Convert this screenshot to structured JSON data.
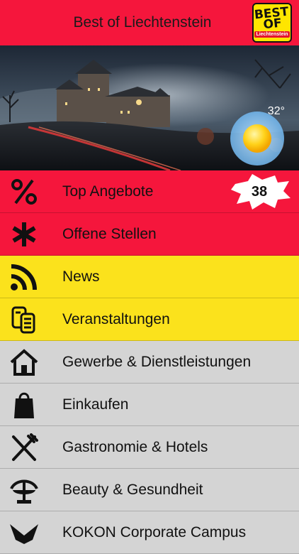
{
  "header": {
    "title": "Best of Liechtenstein",
    "logo_big": "BEST OF",
    "logo_small": "Liechtenstein"
  },
  "weather": {
    "temperature": "32°",
    "icon": "sun-icon"
  },
  "menu": [
    {
      "label": "Top Angebote",
      "icon": "percent-icon",
      "color": "#f5163c",
      "badge": "38"
    },
    {
      "label": "Offene Stellen",
      "icon": "asterisk-icon",
      "color": "#f5163c"
    },
    {
      "label": "News",
      "icon": "rss-icon",
      "color": "#fbe21c"
    },
    {
      "label": "Veranstaltungen",
      "icon": "tickets-icon",
      "color": "#fbe21c"
    },
    {
      "label": "Gewerbe & Dienstleistungen",
      "icon": "house-icon",
      "color": "#d4d4d4"
    },
    {
      "label": "Einkaufen",
      "icon": "shopping-bag-icon",
      "color": "#d4d4d4"
    },
    {
      "label": "Gastronomie & Hotels",
      "icon": "fork-knife-icon",
      "color": "#d4d4d4"
    },
    {
      "label": "Beauty & Gesundheit",
      "icon": "fountain-icon",
      "color": "#d4d4d4"
    },
    {
      "label": "KOKON Corporate Campus",
      "icon": "bird-icon",
      "color": "#d4d4d4"
    }
  ]
}
